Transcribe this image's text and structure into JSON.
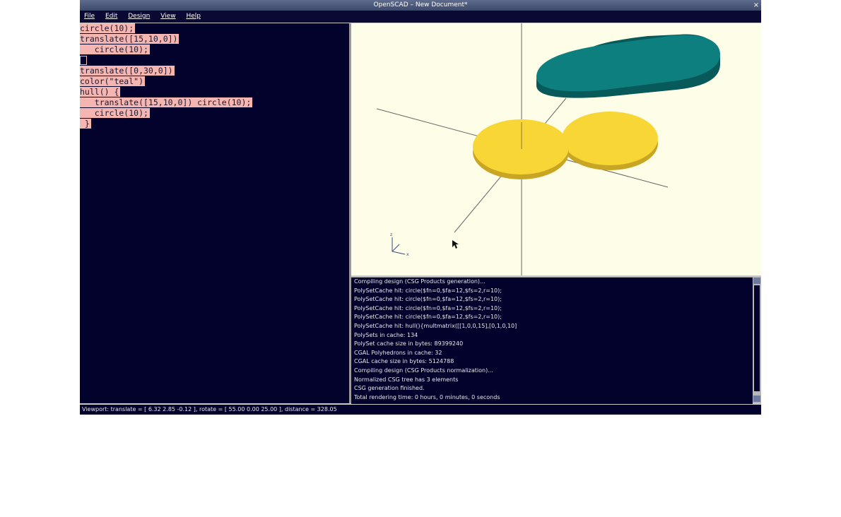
{
  "window": {
    "title": "OpenSCAD – New Document*",
    "close_label": "×"
  },
  "menu": [
    {
      "label": "File"
    },
    {
      "label": "Edit"
    },
    {
      "label": "Design"
    },
    {
      "label": "View"
    },
    {
      "label": "Help"
    }
  ],
  "editor": {
    "lines": [
      "circle(10);",
      "translate([15,10,0])",
      "   circle(10);",
      "",
      "translate([0,30,0])",
      "color(\"teal\")",
      "hull() {",
      "   translate([15,10,0]) circle(10);",
      "   circle(10);",
      " }"
    ]
  },
  "viewport": {
    "axes_labels": {
      "z": "z",
      "x": "x"
    },
    "colors": {
      "background": "#fefde8",
      "teal_fill": "#0d7e7e",
      "yellow_fill": "#f7d636",
      "axis": "#555555"
    }
  },
  "console": {
    "lines": [
      "Compiling design (CSG Products generation)...",
      "PolySetCache hit: circle($fn=0,$fa=12,$fs=2,r=10);",
      "PolySetCache hit: circle($fn=0,$fa=12,$fs=2,r=10);",
      "PolySetCache hit: circle($fn=0,$fa=12,$fs=2,r=10);",
      "PolySetCache hit: circle($fn=0,$fa=12,$fs=2,r=10);",
      "PolySetCache hit: hull(){multmatrix([[1,0,0,15],[0,1,0,10]",
      "PolySets in cache: 134",
      "PolySet cache size in bytes: 89399240",
      "CGAL Polyhedrons in cache: 32",
      "CGAL cache size in bytes: 5124788",
      "Compiling design (CSG Products normalization)...",
      "Normalized CSG tree has 3 elements",
      "CSG generation finished.",
      "Total rendering time: 0 hours, 0 minutes, 0 seconds"
    ]
  },
  "status": {
    "text": "Viewport: translate = [ 6.32 2.85 -0.12 ], rotate = [ 55.00 0.00 25.00 ], distance = 328.05"
  }
}
